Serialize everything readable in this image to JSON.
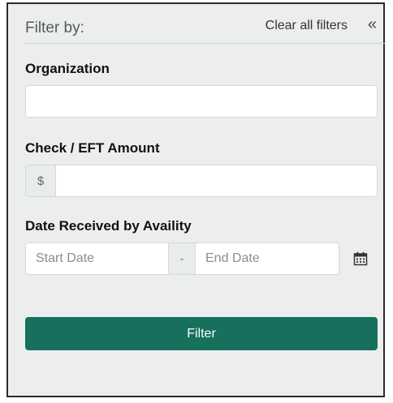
{
  "header": {
    "title": "Filter by:",
    "clear_label": "Clear all filters",
    "collapse_glyph": "«"
  },
  "fields": {
    "organization": {
      "label": "Organization",
      "value": "",
      "placeholder": ""
    },
    "amount": {
      "label": "Check / EFT Amount",
      "currency_symbol": "$",
      "value": "",
      "placeholder": ""
    },
    "date": {
      "label": "Date Received by Availity",
      "start_placeholder": "Start Date",
      "separator": "-",
      "end_placeholder": "End Date",
      "icon": "calendar-icon"
    }
  },
  "actions": {
    "filter_label": "Filter"
  },
  "colors": {
    "panel_bg": "#eceeed",
    "primary": "#17705e",
    "border": "#2b2b2b"
  }
}
